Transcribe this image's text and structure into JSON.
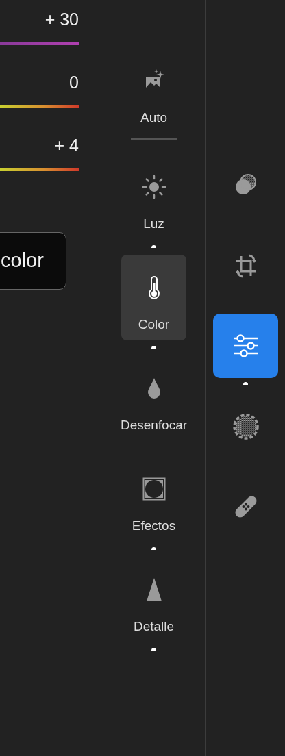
{
  "sliders": [
    {
      "reading": "+ 30",
      "kind": "tint"
    },
    {
      "reading": "0",
      "kind": "warm"
    },
    {
      "reading": "+ 4",
      "kind": "warm"
    }
  ],
  "color_button": {
    "label": "color"
  },
  "panels": [
    {
      "label": "Auto",
      "kind": "auto",
      "selected": false
    },
    {
      "label": "Luz",
      "kind": "panel",
      "selected": false,
      "edited": true
    },
    {
      "label": "Color",
      "kind": "panel",
      "selected": true,
      "edited": true
    },
    {
      "label": "Desenfocar",
      "kind": "panel",
      "selected": false,
      "edited": false
    },
    {
      "label": "Efectos",
      "kind": "panel",
      "selected": false,
      "edited": true
    },
    {
      "label": "Detalle",
      "kind": "panel",
      "selected": false,
      "edited": true
    }
  ],
  "tools": [
    {
      "selected": false,
      "edited": false
    },
    {
      "selected": false,
      "edited": false
    },
    {
      "selected": true,
      "edited": true
    },
    {
      "selected": false,
      "edited": false
    },
    {
      "selected": false,
      "edited": false
    }
  ]
}
